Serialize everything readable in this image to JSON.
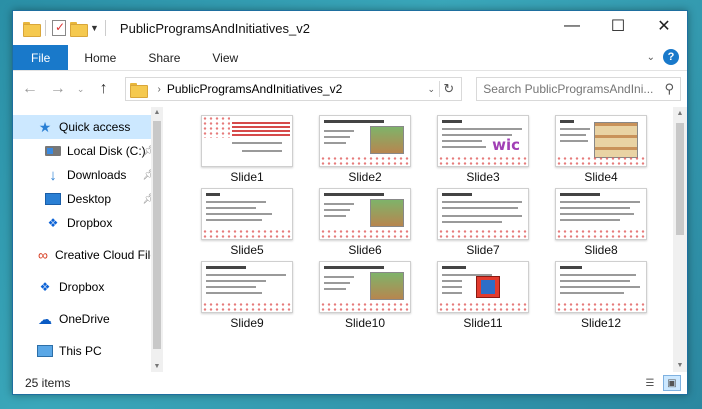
{
  "window": {
    "title": "PublicProgramsAndInitiatives_v2"
  },
  "window_controls": {
    "minimize": "—",
    "maximize": "☐",
    "close": "✕"
  },
  "ribbon": {
    "tabs": [
      "File",
      "Home",
      "Share",
      "View"
    ],
    "help": "?"
  },
  "address": {
    "path": "PublicProgramsAndInitiatives_v2"
  },
  "search": {
    "placeholder": "Search PublicProgramsAndIni..."
  },
  "sidebar": {
    "items": [
      {
        "label": "Quick access",
        "icon": "star-icon"
      },
      {
        "label": "Local Disk (C:)",
        "icon": "disk-icon"
      },
      {
        "label": "Downloads",
        "icon": "download-icon"
      },
      {
        "label": "Desktop",
        "icon": "desktop-icon"
      },
      {
        "label": "Dropbox",
        "icon": "dropbox-icon"
      },
      {
        "label": "Creative Cloud Files",
        "icon": "creative-cloud-icon"
      },
      {
        "label": "Dropbox",
        "icon": "dropbox-icon"
      },
      {
        "label": "OneDrive",
        "icon": "onedrive-icon"
      },
      {
        "label": "This PC",
        "icon": "pc-icon"
      }
    ]
  },
  "files": [
    "Slide1",
    "Slide2",
    "Slide3",
    "Slide4",
    "Slide5",
    "Slide6",
    "Slide7",
    "Slide8",
    "Slide9",
    "Slide10",
    "Slide11",
    "Slide12"
  ],
  "status": {
    "count": "25 items"
  },
  "colors": {
    "accent": "#1979ca",
    "selection": "#cce8ff"
  }
}
